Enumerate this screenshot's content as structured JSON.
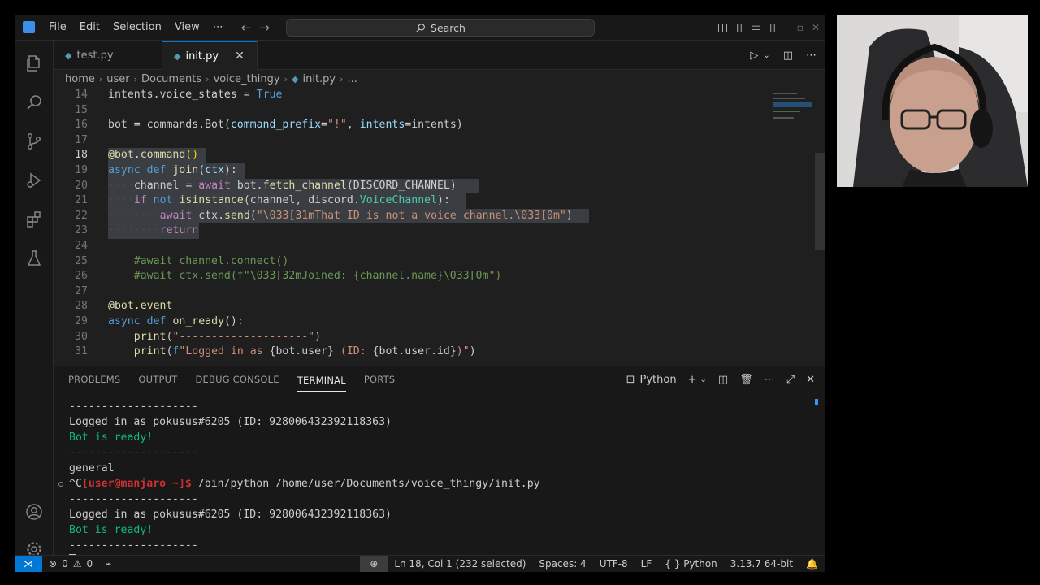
{
  "menu": [
    "File",
    "Edit",
    "Selection",
    "View",
    "⋯"
  ],
  "search": {
    "label": "Search"
  },
  "tabs": [
    {
      "label": "test.py",
      "active": false
    },
    {
      "label": "init.py",
      "active": true
    }
  ],
  "breadcrumb": [
    "home",
    "user",
    "Documents",
    "voice_thingy",
    "init.py",
    "..."
  ],
  "code_lines": [
    {
      "n": "14",
      "html": "intents.voice_states = <span class='n'>True</span>"
    },
    {
      "n": "15",
      "html": ""
    },
    {
      "n": "16",
      "html": "bot = commands.Bot(<span class='p'>command_prefix</span>=<span class='s'>\"!\"</span>, <span class='p'>intents</span>=intents)"
    },
    {
      "n": "17",
      "html": ""
    },
    {
      "n": "18",
      "html": "<span class='f'>@bot.command</span><span class='b'>()</span>",
      "sel": 15,
      "cur": true
    },
    {
      "n": "19",
      "html": "<span class='k'>async</span> <span class='k'>def</span> <span class='f'>join</span>(<span class='p'>ctx</span>):",
      "sel": 21
    },
    {
      "n": "20",
      "html": "····channel = <span class='kc'>await</span> bot.<span class='f'>fetch_channel</span>(DISCORD_CHANNEL)",
      "sel": 57
    },
    {
      "n": "21",
      "html": "····<span class='kc'>if</span> <span class='k'>not</span> <span class='f'>isinstance</span>(channel, discord.<span class='t'>VoiceChannel</span>):",
      "sel": 55
    },
    {
      "n": "22",
      "html": "········<span class='kc'>await</span> ctx.<span class='f'>send</span>(<span class='s'>\"\\033[31mThat ID is not a voice channel.\\033[0m\"</span>)",
      "sel": 74
    },
    {
      "n": "23",
      "html": "········<span class='kc'>return</span>",
      "sel": 14
    },
    {
      "n": "24",
      "html": ""
    },
    {
      "n": "25",
      "html": "    <span class='c'>#await channel.connect()</span>"
    },
    {
      "n": "26",
      "html": "    <span class='c'>#await ctx.send(f\"\\033[32mJoined: {channel.name}\\033[0m\")</span>"
    },
    {
      "n": "27",
      "html": ""
    },
    {
      "n": "28",
      "html": "<span class='f'>@bot.event</span>"
    },
    {
      "n": "29",
      "html": "<span class='k'>async</span> <span class='k'>def</span> <span class='f'>on_ready</span>():"
    },
    {
      "n": "30",
      "html": "    <span class='f'>print</span>(<span class='s'>\"--------------------\"</span>)"
    },
    {
      "n": "31",
      "html": "    <span class='f'>print</span>(<span class='k'>f</span><span class='s'>\"Logged in as </span>{bot.user}<span class='s'> (ID: </span>{bot.user.id}<span class='s'>)\"</span>)"
    }
  ],
  "panel": {
    "tabs": [
      "PROBLEMS",
      "OUTPUT",
      "DEBUG CONSOLE",
      "TERMINAL",
      "PORTS"
    ],
    "active_tab": "TERMINAL",
    "terminal_name": "Python"
  },
  "terminal": [
    {
      "text": "--------------------",
      "cls": ""
    },
    {
      "text": "Logged in as pokusus#6205 (ID: 928006432392118363)",
      "cls": ""
    },
    {
      "text": "Bot is ready!",
      "cls": "green"
    },
    {
      "text": "--------------------",
      "cls": ""
    },
    {
      "text": "general",
      "cls": ""
    },
    {
      "text": "",
      "cls": "prompt-line",
      "dot": true,
      "pre": "^C",
      "prompt": "[user@manjaro ~]$",
      "cmd": " /bin/python /home/user/Documents/voice_thingy/init.py"
    },
    {
      "text": "--------------------",
      "cls": ""
    },
    {
      "text": "Logged in as pokusus#6205 (ID: 928006432392118363)",
      "cls": ""
    },
    {
      "text": "Bot is ready!",
      "cls": "green"
    },
    {
      "text": "--------------------",
      "cls": ""
    }
  ],
  "status": {
    "errors": "0",
    "warnings": "0",
    "position": "Ln 18, Col 1 (232 selected)",
    "spaces": "Spaces: 4",
    "encoding": "UTF-8",
    "eol": "LF",
    "language": "Python",
    "interpreter": "3.13.7 64-bit"
  },
  "colors": {
    "accent": "#0078d4",
    "bg": "#1f1f1f",
    "terminal_green": "#0dbc79"
  }
}
